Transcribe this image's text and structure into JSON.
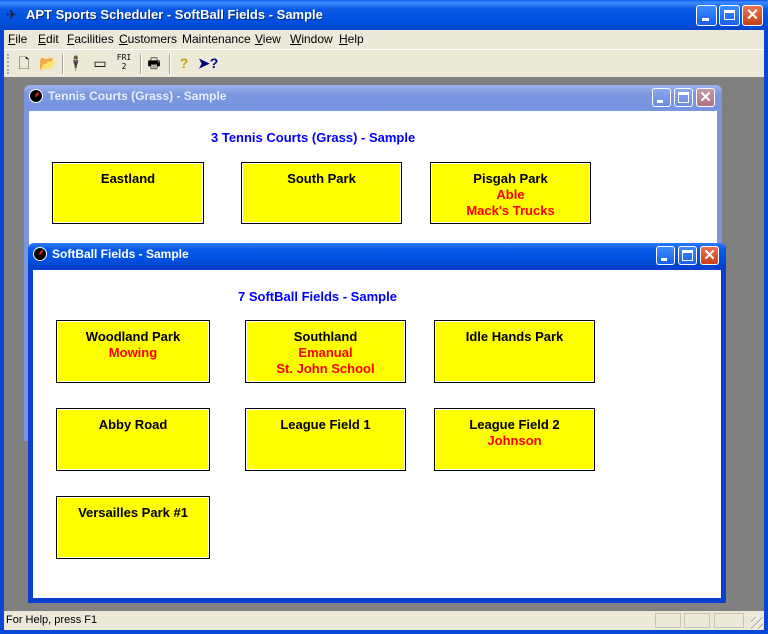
{
  "app": {
    "title": "APT Sports Scheduler - SoftBall Fields - Sample",
    "icon": "app-logo-icon",
    "accent_color": "#0050e0"
  },
  "menu": [
    {
      "label": "File",
      "accel": "F"
    },
    {
      "label": "Edit",
      "accel": "E"
    },
    {
      "label": "Facilities",
      "accel": "F"
    },
    {
      "label": "Customers",
      "accel": "C"
    },
    {
      "label": "Maintenance",
      "accel": ""
    },
    {
      "label": "View",
      "accel": "V"
    },
    {
      "label": "Window",
      "accel": "W"
    },
    {
      "label": "Help",
      "accel": "H"
    }
  ],
  "toolbar": {
    "new": "new-document-icon",
    "open": "open-folder-icon",
    "customer": "person-icon",
    "facility": "facility-rectangle-icon",
    "calendar_text": "FRI 2",
    "print": "printer-icon",
    "help": "help-question-icon",
    "context_help": "context-help-pointer-icon"
  },
  "windows": {
    "tennis": {
      "title": "Tennis Courts (Grass) - Sample",
      "heading": "3 Tennis Courts (Grass) - Sample",
      "facilities": [
        {
          "name": "Eastland",
          "notes": []
        },
        {
          "name": "South Park",
          "notes": []
        },
        {
          "name": "Pisgah Park",
          "notes": [
            "Able",
            "Mack's Trucks"
          ]
        }
      ]
    },
    "softball": {
      "title": "SoftBall Fields - Sample",
      "heading": "7 SoftBall Fields - Sample",
      "facilities": [
        {
          "name": "Woodland Park",
          "notes": [
            "Mowing"
          ]
        },
        {
          "name": "Southland",
          "notes": [
            "Emanual",
            "St. John School"
          ]
        },
        {
          "name": "Idle Hands Park",
          "notes": []
        },
        {
          "name": "Abby Road",
          "notes": []
        },
        {
          "name": "League Field 1",
          "notes": []
        },
        {
          "name": "League Field 2",
          "notes": [
            "Johnson"
          ]
        },
        {
          "name": "Versailles Park #1",
          "notes": []
        }
      ]
    }
  },
  "colors": {
    "facility_bg": "#ffff00",
    "facility_name": "#000000",
    "facility_note": "#ff0000",
    "heading": "#0000ff"
  },
  "status": {
    "text": "For Help, press F1"
  }
}
